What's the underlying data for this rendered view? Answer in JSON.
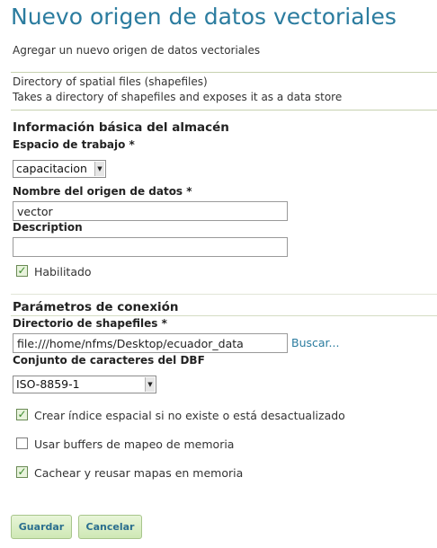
{
  "page": {
    "title": "Nuevo origen de datos vectoriales",
    "subtitle": "Agregar un nuevo origen de datos vectoriales"
  },
  "store_type": {
    "name": "Directory of spatial files (shapefiles)",
    "description": "Takes a directory of shapefiles and exposes it as a data store"
  },
  "basic": {
    "section_title": "Información básica del almacén",
    "workspace_label": "Espacio de trabajo *",
    "workspace_value": "capacitacion",
    "name_label": "Nombre del origen de datos *",
    "name_value": "vector",
    "description_label": "Description",
    "description_value": "",
    "enabled_label": "Habilitado",
    "enabled_checked": true
  },
  "connection": {
    "section_title": "Parámetros de conexión",
    "directory_label": "Directorio de shapefiles *",
    "directory_value": "file:///home/nfms/Desktop/ecuador_data",
    "browse_label": "Buscar...",
    "charset_label": "Conjunto de caracteres del DBF",
    "charset_value": "ISO-8859-1",
    "options": [
      {
        "label": "Crear índice espacial si no existe o está desactualizado",
        "checked": true
      },
      {
        "label": "Usar buffers de mapeo de memoria",
        "checked": false
      },
      {
        "label": "Cachear y reusar mapas en memoria",
        "checked": true
      }
    ]
  },
  "buttons": {
    "save": "Guardar",
    "cancel": "Cancelar"
  },
  "colors": {
    "title": "#2b7c9f",
    "link": "#2b7c9f",
    "button_bg": "#d9edc5",
    "check_mark": "#3c8a2c"
  },
  "icons": {
    "checkbox_checked": "check-mark",
    "dropdown": "triangle-down"
  }
}
